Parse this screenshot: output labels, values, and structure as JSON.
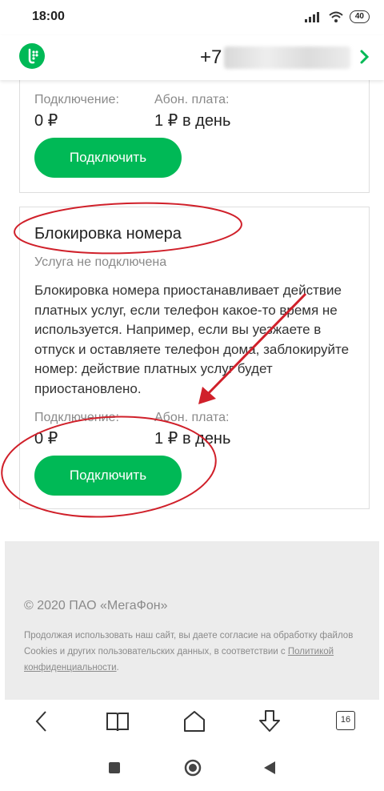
{
  "status_bar": {
    "time": "18:00",
    "battery": "40"
  },
  "header": {
    "phone_prefix": "+7"
  },
  "card1": {
    "connection_label": "Подключение:",
    "connection_value": "0 ₽",
    "fee_label": "Абон. плата:",
    "fee_value": "1 ₽ в день",
    "button_label": "Подключить"
  },
  "card2": {
    "title": "Блокировка номера",
    "status": "Услуга не подключена",
    "description": "Блокировка номера приостанавливает действие платных услуг, если телефон какое-то время не используется. Например, если вы уезжаете в отпуск и оставляете телефон дома, заблокируйте номер: действие платных услуг будет приостановлено.",
    "connection_label": "Подключение:",
    "connection_value": "0 ₽",
    "fee_label": "Абон. плата:",
    "fee_value": "1 ₽ в день",
    "button_label": "Подключить"
  },
  "footer": {
    "copyright": "© 2020 ПАО «МегаФон»",
    "legal_text": "Продолжая использовать наш сайт, вы даете согласие на обработку файлов Cookies и других пользовательских данных, в соответствии с",
    "privacy_link": "Политикой конфиденциальности",
    "legal_end": "."
  },
  "browser_bar": {
    "tabs_count": "16"
  },
  "colors": {
    "brand_green": "#00b956",
    "annotation_red": "#d0202a"
  }
}
